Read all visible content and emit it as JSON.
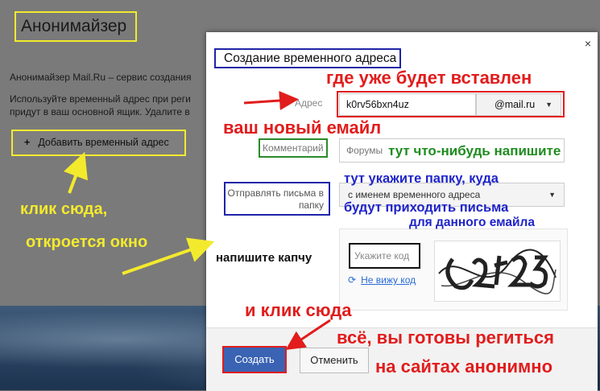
{
  "background": {
    "title": "Анонимайзер",
    "description": [
      "Анонимайзер Mail.Ru – сервис создания",
      "Используйте временный адрес при реги",
      "придут в ваш основной ящик. Удалите в"
    ],
    "add_button_label": "Добавить временный адрес"
  },
  "dialog": {
    "title": "Создание временного адреса",
    "close": "×",
    "address_label": "Адрес",
    "address_value": "k0rv56bxn4uz",
    "domain_value": "@mail.ru",
    "comment_label": "Комментарий",
    "comment_placeholder": "Форумы",
    "folder_label": "Отправлять письма в папку",
    "folder_value": "с именем временного адреса",
    "captcha_placeholder": "Укажите код",
    "captcha_refresh_link": "Не вижу код",
    "create_button": "Создать",
    "cancel_button": "Отменить"
  },
  "annotations": {
    "inserted": "где уже будет вставлен",
    "new_email": "ваш новый емайл",
    "write_something": "тут что-нибудь напишите",
    "folder_line1": "тут укажите папку, куда",
    "folder_line2": "будут приходить письма",
    "folder_line3": "для данного емайла",
    "click_here": "клик сюда,",
    "window_opens": "откроется окно",
    "write_captcha": "напишите капчу",
    "click_here2": "и клик сюда",
    "ready_line1": "всё, вы готовы региться",
    "ready_line2": "на сайтах анонимно"
  },
  "colors": {
    "annotation_red": "#e21c1c",
    "annotation_green": "#1f8c1f",
    "annotation_blue": "#1f24c8",
    "annotation_yellow": "#f3ea2d",
    "primary_button": "#3a63b4"
  }
}
